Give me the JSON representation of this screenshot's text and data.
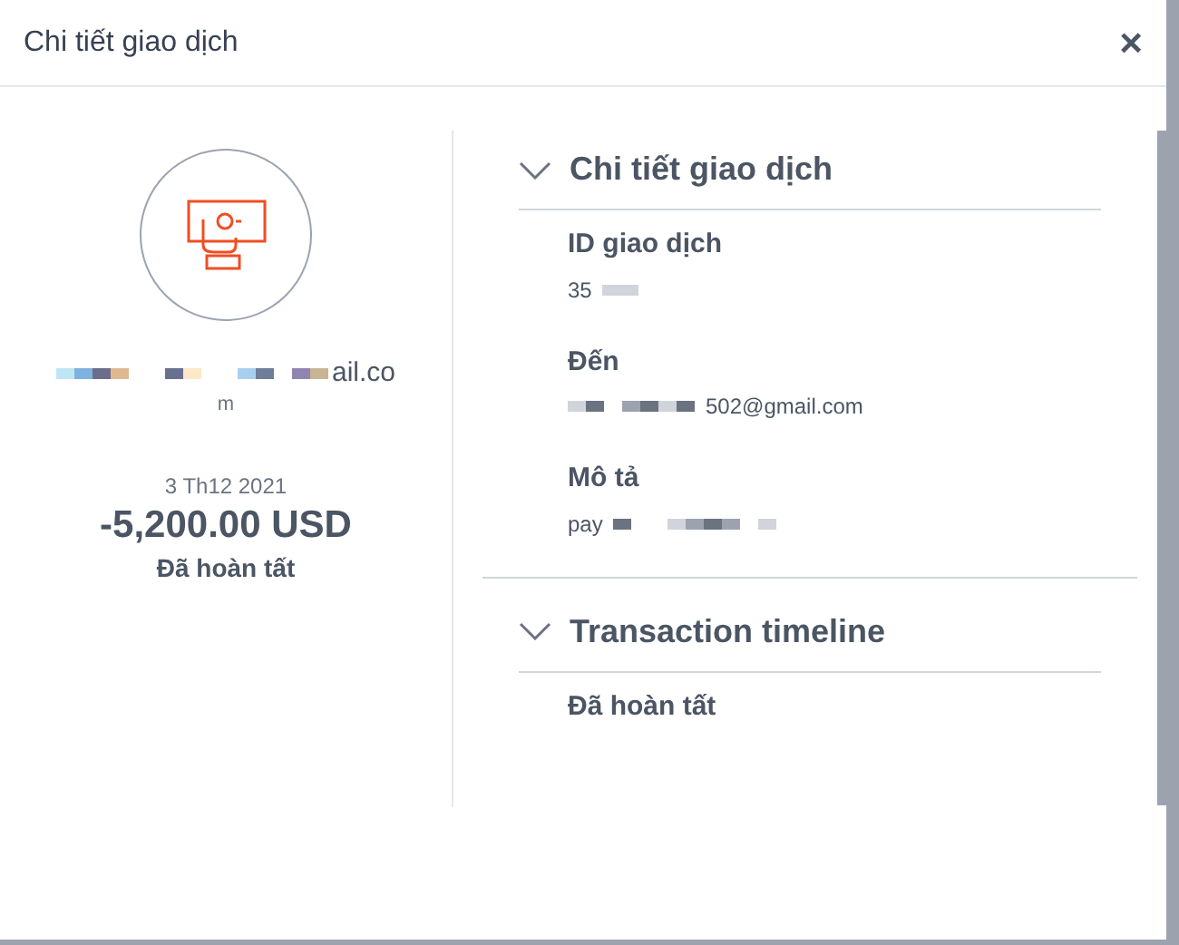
{
  "dialog": {
    "title": "Chi tiết giao dịch",
    "close": "×"
  },
  "summary": {
    "email_tail": "ail.co",
    "email_wrap": "m",
    "date": "3 Th12 2021",
    "amount": "-5,200.00 USD",
    "status": "Đã hoàn tất"
  },
  "sections": [
    {
      "title": "Chi tiết giao dịch",
      "expanded": true,
      "fields": [
        {
          "label": "ID giao dịch",
          "value": "35"
        },
        {
          "label": "Đến",
          "value": "502@gmail.com"
        },
        {
          "label": "Mô tả",
          "value": "pay"
        }
      ]
    },
    {
      "title": "Transaction timeline",
      "expanded": true,
      "fields": [
        {
          "label": "Đã hoàn tất"
        }
      ]
    }
  ]
}
